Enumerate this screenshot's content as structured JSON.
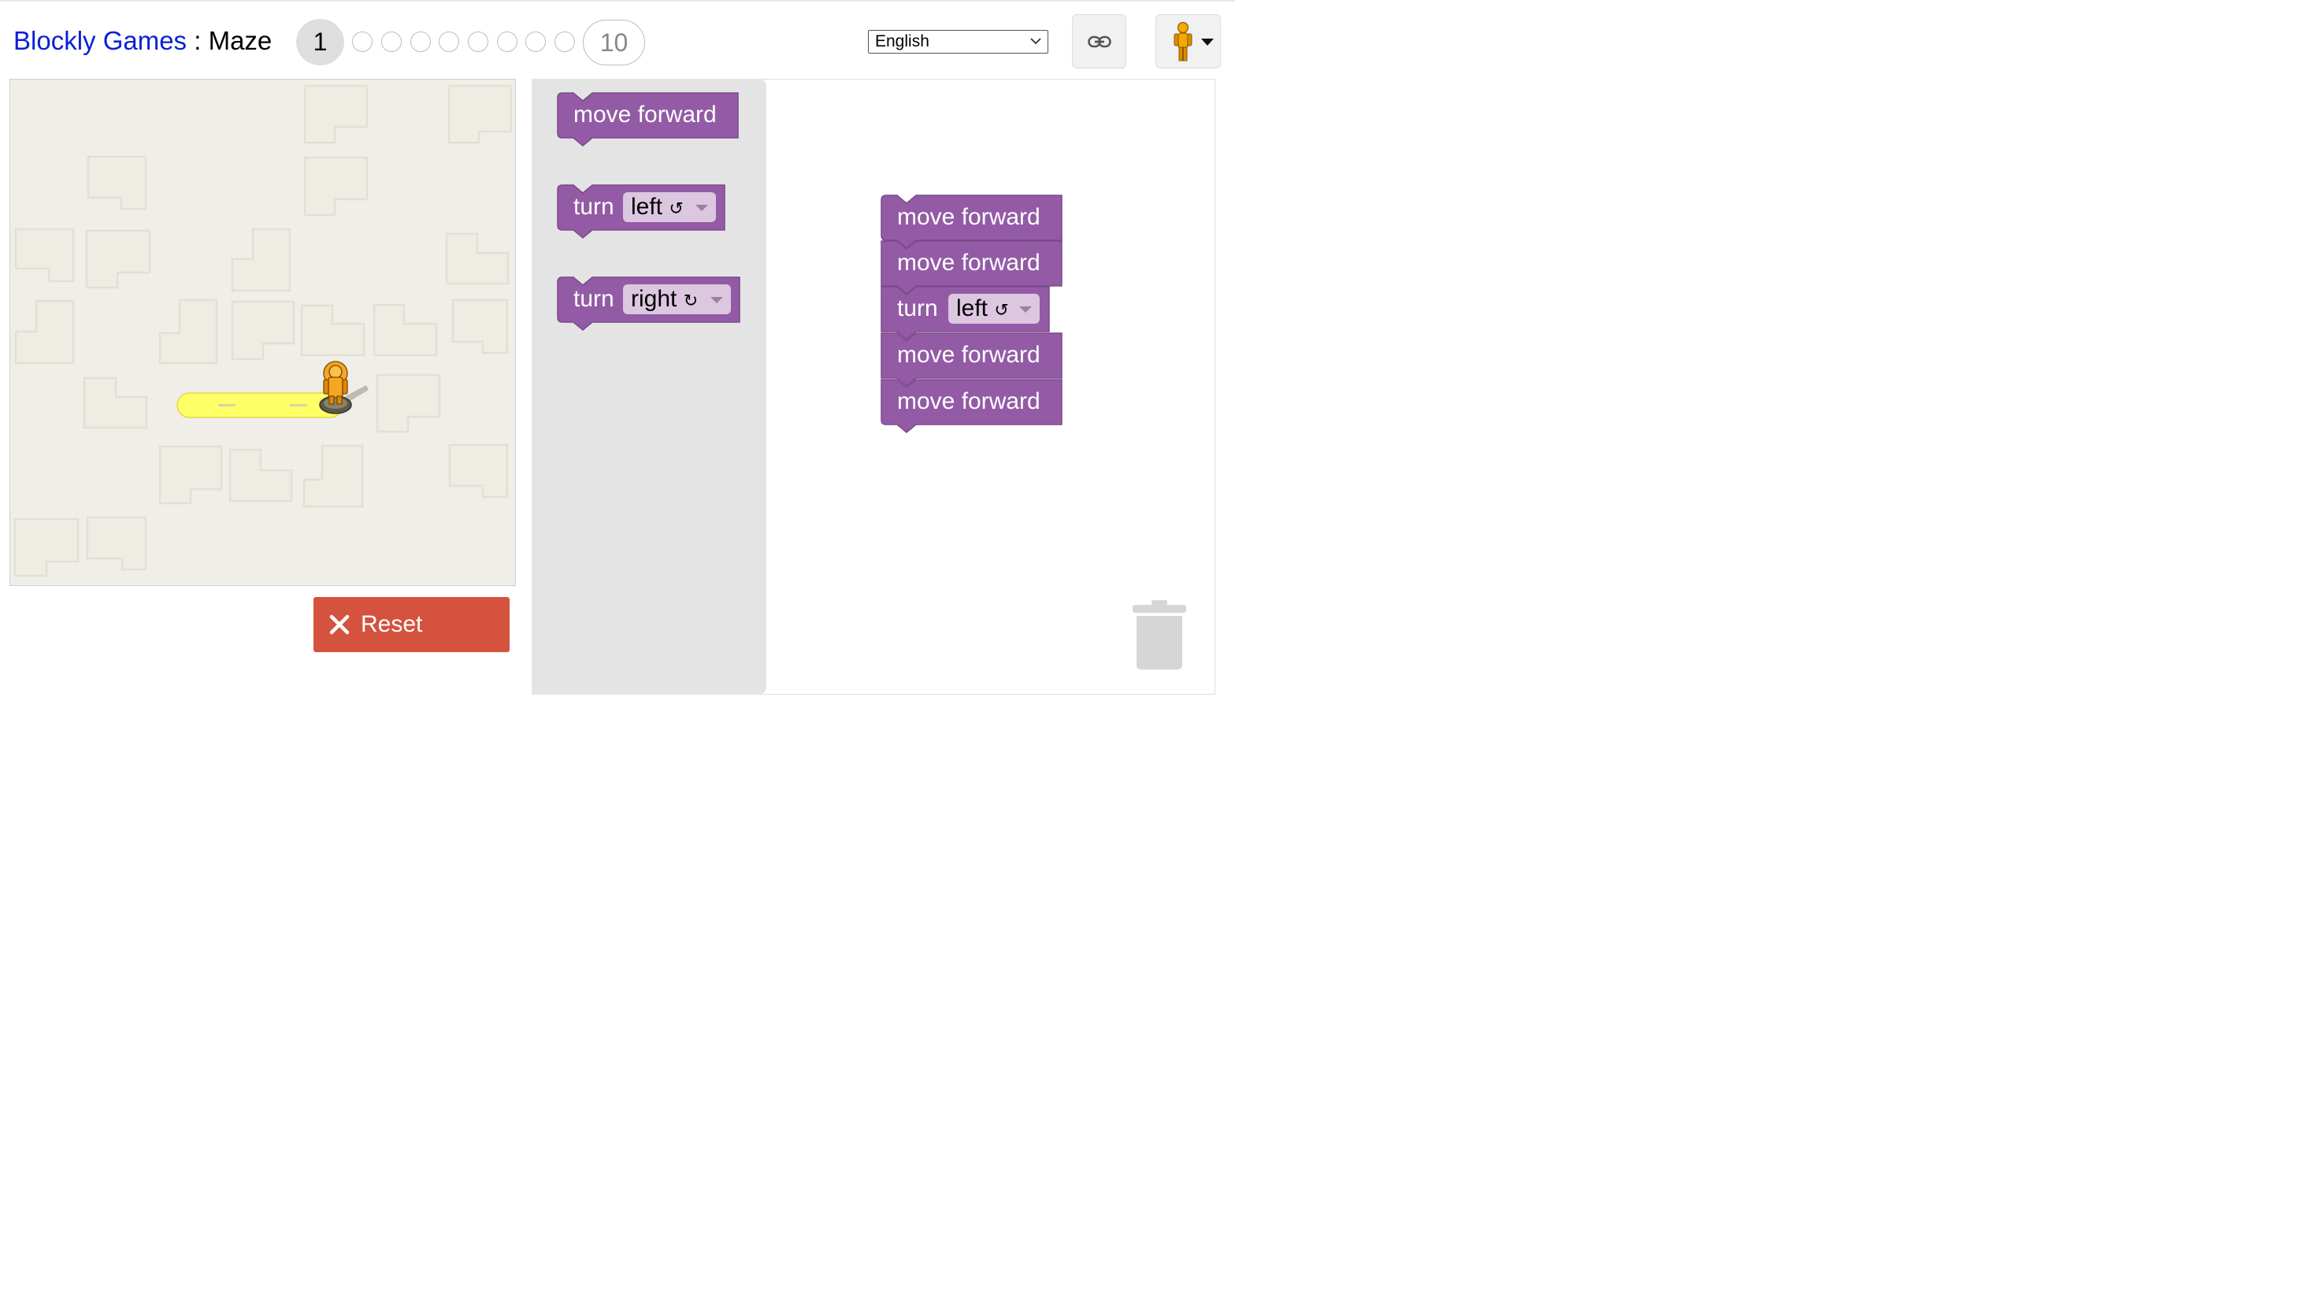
{
  "header": {
    "app_name": "Blockly Games",
    "separator": " : ",
    "game_name": "Maze",
    "current_level": "1",
    "last_level": "10",
    "language": "English",
    "link_icon": "link-icon",
    "avatar_icon": "pegman-icon"
  },
  "maze": {
    "walls_color": "#f0eee8",
    "path_color": "#ffff66",
    "pegman_icon": "pegman-icon"
  },
  "controls": {
    "reset_label": "Reset",
    "reset_icon": "close-icon",
    "reset_color": "#d4523e"
  },
  "toolbox": {
    "move_label": "move forward",
    "turn_label": "turn",
    "left_label": "left",
    "left_arrow": "↺",
    "right_label": "right",
    "right_arrow": "↻"
  },
  "program": {
    "blocks": [
      {
        "label": "move forward"
      },
      {
        "label": "move forward"
      },
      {
        "label": "turn",
        "option": "left",
        "arrow": "↺"
      },
      {
        "label": "move forward"
      },
      {
        "label": "move forward"
      }
    ],
    "block_color": "#935ba5"
  },
  "workspace": {
    "trash_icon": "trash-icon"
  }
}
